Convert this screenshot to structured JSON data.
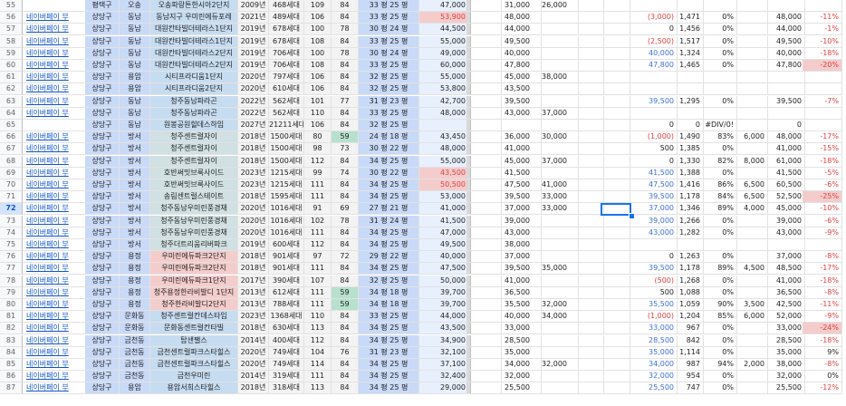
{
  "sheet": {
    "link_text": "네이버페이 부",
    "selected_row": "72",
    "rows": [
      {
        "n": "55",
        "d": "평택구",
        "t": "오송",
        "c": "오송파랑튼한시아2단지",
        "y": "2009년",
        "h": "468세대",
        "a": "109",
        "b": "84",
        "p": "33 평 25 평",
        "pr": "47,000",
        "hi": "",
        "p1": "31,000",
        "p2": "26,000",
        "chg": "",
        "v": "",
        "pct": "",
        "z": "",
        "w": "",
        "dr": ""
      },
      {
        "n": "56",
        "d": "상당구",
        "t": "동남",
        "c": "동남지구 우미린에듀포레",
        "y": "2021년",
        "h": "489세대",
        "a": "106",
        "b": "84",
        "p": "33 평 25 평",
        "pr": "53,900",
        "hi": "red",
        "p1": "48,000",
        "p2": "",
        "chg": "(3,000)",
        "v": "1,471",
        "pct": "0%",
        "z": "",
        "w": "48,000",
        "dr": "-11%"
      },
      {
        "n": "57",
        "d": "상당구",
        "t": "동남",
        "c": "대원칸타빌더테라스1단지",
        "y": "2019년",
        "h": "678세대",
        "a": "100",
        "b": "78",
        "p": "30 평 24 평",
        "pr": "44,500",
        "hi": "",
        "p1": "44,000",
        "p2": "",
        "chg": "0",
        "v": "1,456",
        "pct": "0%",
        "z": "",
        "w": "44,000",
        "dr": "-1%"
      },
      {
        "n": "58",
        "d": "상당구",
        "t": "동남",
        "c": "대원칸타빌더테라스1단지",
        "y": "2019년",
        "h": "678세대",
        "a": "108",
        "b": "84",
        "p": "33 평 25 평",
        "pr": "55,000",
        "hi": "",
        "p1": "49,500",
        "p2": "",
        "chg": "(2,500)",
        "v": "1,517",
        "pct": "0%",
        "z": "",
        "w": "49,500",
        "dr": "-10%"
      },
      {
        "n": "59",
        "d": "상당구",
        "t": "동남",
        "c": "대원칸타빌더테라스2단지",
        "y": "2019년",
        "h": "706세대",
        "a": "100",
        "b": "78",
        "p": "30 평 24 평",
        "pr": "49,000",
        "hi": "",
        "p1": "40,000",
        "p2": "",
        "chg": "40,000",
        "v": "1,324",
        "pct": "0%",
        "z": "",
        "w": "40,000",
        "dr": "-18%"
      },
      {
        "n": "60",
        "d": "상당구",
        "t": "동남",
        "c": "대원칸타빌더테라스2단지",
        "y": "2019년",
        "h": "706세대",
        "a": "108",
        "b": "84",
        "p": "33 평 25 평",
        "pr": "60,000",
        "hi": "",
        "p1": "47,800",
        "p2": "",
        "chg": "47,800",
        "v": "1,465",
        "pct": "0%",
        "z": "",
        "w": "47,800",
        "dr": "-20%"
      },
      {
        "n": "61",
        "d": "상당구",
        "t": "용암",
        "c": "시티프라디움1단지",
        "y": "2020년",
        "h": "797세대",
        "a": "106",
        "b": "84",
        "p": "32 평 25 평",
        "pr": "55,000",
        "hi": "",
        "p1": "45,000",
        "p2": "38,000",
        "chg": "",
        "v": "",
        "pct": "",
        "z": "",
        "w": "",
        "dr": ""
      },
      {
        "n": "62",
        "d": "상당구",
        "t": "용암",
        "c": "시티프라디움2단지",
        "y": "2020년",
        "h": "610세대",
        "a": "106",
        "b": "84",
        "p": "32 평 25 평",
        "pr": "53,800",
        "hi": "",
        "p1": "43,500",
        "p2": "",
        "chg": "",
        "v": "",
        "pct": "",
        "z": "",
        "w": "",
        "dr": ""
      },
      {
        "n": "63",
        "d": "상당구",
        "t": "동남",
        "c": "청주동남파라곤",
        "y": "2022년",
        "h": "562세대",
        "a": "101",
        "b": "77",
        "p": "31 평 23 평",
        "pr": "42,700",
        "hi": "",
        "p1": "39,500",
        "p2": "",
        "chg": "39,500",
        "v": "1,295",
        "pct": "0%",
        "z": "",
        "w": "39,500",
        "dr": "-7%"
      },
      {
        "n": "64",
        "d": "상당구",
        "t": "동남",
        "c": "청주동남파라곤",
        "y": "2022년",
        "h": "562세대",
        "a": "110",
        "b": "84",
        "p": "33 평 25 평",
        "pr": "48,000",
        "hi": "",
        "p1": "43,000",
        "p2": "37,000",
        "chg": "",
        "v": "",
        "pct": "",
        "z": "",
        "w": "",
        "dr": ""
      },
      {
        "n": "65",
        "d": "상당구",
        "t": "동남",
        "c": "원봉공원힐데스하임",
        "y": "2027년",
        "h": "21211세대",
        "a": "106",
        "b": "84",
        "p": "32 평 25 평",
        "pr": "",
        "hi": "",
        "p1": "",
        "p2": "",
        "chg": "0",
        "v": "0",
        "pct": "#DIV/0!",
        "z": "",
        "w": "0",
        "dr": ""
      },
      {
        "n": "66",
        "d": "상당구",
        "t": "방서",
        "c": "청주센트럴자이",
        "y": "2018년",
        "h": "1500세대",
        "a": "80",
        "b": "59",
        "p": "24 평 18 평",
        "pr": "43,450",
        "hi": "",
        "p1": "36,000",
        "p2": "30,000",
        "chg": "(1,000)",
        "v": "1,490",
        "pct": "83%",
        "z": "6,000",
        "w": "48,000",
        "dr": "-17%"
      },
      {
        "n": "67",
        "d": "상당구",
        "t": "방서",
        "c": "청주센트럴자이",
        "y": "2018년",
        "h": "1500세대",
        "a": "98",
        "b": "73",
        "p": "30 평 22 평",
        "pr": "48,000",
        "hi": "",
        "p1": "41,000",
        "p2": "",
        "chg": "500",
        "v": "1,385",
        "pct": "0%",
        "z": "",
        "w": "41,000",
        "dr": "-15%"
      },
      {
        "n": "68",
        "d": "상당구",
        "t": "방서",
        "c": "청주센트럴자이",
        "y": "2018년",
        "h": "1500세대",
        "a": "112",
        "b": "84",
        "p": "34 평 25 평",
        "pr": "55,000",
        "hi": "",
        "p1": "45,000",
        "p2": "37,000",
        "chg": "0",
        "v": "1,330",
        "pct": "82%",
        "z": "8,000",
        "w": "61,000",
        "dr": "-18%"
      },
      {
        "n": "69",
        "d": "상당구",
        "t": "방서",
        "c": "호반써밋브룩사이드",
        "y": "2023년",
        "h": "1215세대",
        "a": "99",
        "b": "74",
        "p": "30 평 22 평",
        "pr": "43,500",
        "hi": "red",
        "p1": "41,500",
        "p2": "",
        "chg": "41,500",
        "v": "1,388",
        "pct": "0%",
        "z": "",
        "w": "41,500",
        "dr": "-5%"
      },
      {
        "n": "70",
        "d": "상당구",
        "t": "방서",
        "c": "호반써밋브룩사이드",
        "y": "2023년",
        "h": "1215세대",
        "a": "111",
        "b": "84",
        "p": "34 평 25 평",
        "pr": "50,500",
        "hi": "red",
        "p1": "47,500",
        "p2": "41,000",
        "chg": "47,500",
        "v": "1,416",
        "pct": "86%",
        "z": "6,500",
        "w": "60,500",
        "dr": "-6%"
      },
      {
        "n": "71",
        "d": "상당구",
        "t": "방서",
        "c": "송림센트럴스테이트",
        "y": "2018년",
        "h": "1595세대",
        "a": "111",
        "b": "84",
        "p": "34 평 25 평",
        "pr": "53,000",
        "hi": "",
        "p1": "39,500",
        "p2": "33,000",
        "chg": "39,500",
        "v": "1,178",
        "pct": "84%",
        "z": "6,500",
        "w": "52,500",
        "dr": "-25%"
      },
      {
        "n": "72",
        "d": "상당구",
        "t": "방서",
        "c": "청주동남우미린풍경채",
        "y": "2020년",
        "h": "1016세대",
        "a": "91",
        "b": "69",
        "p": "27 평 21 평",
        "pr": "41,000",
        "hi": "",
        "p1": "37,000",
        "p2": "33,000",
        "chg": "37,000",
        "v": "1,346",
        "pct": "89%",
        "z": "4,000",
        "w": "45,000",
        "dr": "-10%"
      },
      {
        "n": "73",
        "d": "상당구",
        "t": "방서",
        "c": "청주동남우미린풍경채",
        "y": "2020년",
        "h": "1016세대",
        "a": "102",
        "b": "78",
        "p": "31 평 24 평",
        "pr": "41,500",
        "hi": "",
        "p1": "39,000",
        "p2": "",
        "chg": "39,000",
        "v": "1,266",
        "pct": "0%",
        "z": "",
        "w": "39,000",
        "dr": "-6%"
      },
      {
        "n": "74",
        "d": "상당구",
        "t": "방서",
        "c": "청주동남우미린풍경채",
        "y": "2020년",
        "h": "1016세대",
        "a": "111",
        "b": "84",
        "p": "34 평 25 평",
        "pr": "47,000",
        "hi": "",
        "p1": "43,000",
        "p2": "",
        "chg": "43,000",
        "v": "1,282",
        "pct": "0%",
        "z": "",
        "w": "43,000",
        "dr": "-9%"
      },
      {
        "n": "75",
        "d": "상당구",
        "t": "방서",
        "c": "청주더트리움리버파크",
        "y": "2019년",
        "h": "600세대",
        "a": "112",
        "b": "84",
        "p": "34 평 25 평",
        "pr": "49,500",
        "hi": "",
        "p1": "38,000",
        "p2": "",
        "chg": "",
        "v": "",
        "pct": "",
        "z": "",
        "w": "",
        "dr": ""
      },
      {
        "n": "76",
        "d": "상당구",
        "t": "용정",
        "c": "우미린에듀파크2단지",
        "y": "2018년",
        "h": "901세대",
        "a": "97",
        "b": "72",
        "p": "29 평 22 평",
        "pr": "40,000",
        "hi": "",
        "p1": "37,000",
        "p2": "",
        "chg": "0",
        "v": "1,263",
        "pct": "0%",
        "z": "",
        "w": "37,000",
        "dr": "-8%"
      },
      {
        "n": "77",
        "d": "상당구",
        "t": "용정",
        "c": "우미린에듀파크2단지",
        "y": "2018년",
        "h": "901세대",
        "a": "111",
        "b": "84",
        "p": "34 평 25 평",
        "pr": "47,500",
        "hi": "",
        "p1": "39,500",
        "p2": "35,000",
        "chg": "39,500",
        "v": "1,178",
        "pct": "89%",
        "z": "4,500",
        "w": "48,500",
        "dr": "-17%"
      },
      {
        "n": "78",
        "d": "상당구",
        "t": "용정",
        "c": "우미린에듀파크1단지",
        "y": "2017년",
        "h": "390세대",
        "a": "107",
        "b": "84",
        "p": "32 평 25 평",
        "pr": "50,000",
        "hi": "",
        "p1": "41,000",
        "p2": "",
        "chg": "(500)",
        "v": "1,268",
        "pct": "0%",
        "z": "",
        "w": "41,000",
        "dr": "-18%"
      },
      {
        "n": "79",
        "d": "상당구",
        "t": "용정",
        "c": "청주용정한라비발디 1단지",
        "y": "2013년",
        "h": "612세대",
        "a": "111",
        "b": "59",
        "p": "34 평 18 평",
        "pr": "39,700",
        "hi": "",
        "p1": "36,500",
        "p2": "",
        "chg": "500",
        "v": "1,088",
        "pct": "0%",
        "z": "",
        "w": "36,500",
        "dr": "-8%"
      },
      {
        "n": "80",
        "d": "상당구",
        "t": "용정",
        "c": "청주한라비발디2단지",
        "y": "2013년",
        "h": "788세대",
        "a": "111",
        "b": "59",
        "p": "34 평 18 평",
        "pr": "39,700",
        "hi": "",
        "p1": "35,500",
        "p2": "32,000",
        "chg": "35,500",
        "v": "1,059",
        "pct": "90%",
        "z": "3,500",
        "w": "42,500",
        "dr": "-11%"
      },
      {
        "n": "81",
        "d": "상당구",
        "t": "문화동",
        "c": "청주센트럴칸데스타임",
        "y": "2023년",
        "h": "1368세대",
        "a": "110",
        "b": "84",
        "p": "33 평 25 평",
        "pr": "44,000",
        "hi": "",
        "p1": "40,000",
        "p2": "34,000",
        "chg": "(1,000)",
        "v": "1,204",
        "pct": "85%",
        "z": "6,000",
        "w": "52,000",
        "dr": "-9%"
      },
      {
        "n": "82",
        "d": "상당구",
        "t": "문화동",
        "c": "문화동센트럴칸타빌",
        "y": "2018년",
        "h": "630세대",
        "a": "113",
        "b": "84",
        "p": "34 평 25 평",
        "pr": "43,500",
        "hi": "",
        "p1": "33,000",
        "p2": "",
        "chg": "33,000",
        "v": "967",
        "pct": "0%",
        "z": "",
        "w": "33,000",
        "dr": "-24%"
      },
      {
        "n": "83",
        "d": "상당구",
        "t": "금천동",
        "c": "탑샌팰스",
        "y": "2014년",
        "h": "400세대",
        "a": "112",
        "b": "84",
        "p": "34 평 25 평",
        "pr": "34,900",
        "hi": "",
        "p1": "28,500",
        "p2": "",
        "chg": "28,500",
        "v": "842",
        "pct": "0%",
        "z": "",
        "w": "28,500",
        "dr": "-18%"
      },
      {
        "n": "84",
        "d": "상당구",
        "t": "금천동",
        "c": "금천센트럴파크스타힐스",
        "y": "2020년",
        "h": "749세대",
        "a": "104",
        "b": "76",
        "p": "31 평 23 평",
        "pr": "32,100",
        "hi": "",
        "p1": "35,000",
        "p2": "",
        "chg": "35,000",
        "v": "1,114",
        "pct": "0%",
        "z": "",
        "w": "35,000",
        "dr": "9%"
      },
      {
        "n": "85",
        "d": "상당구",
        "t": "금천동",
        "c": "금천센트럴파크스타힐스",
        "y": "2020년",
        "h": "749세대",
        "a": "114",
        "b": "84",
        "p": "34 평 25 평",
        "pr": "37,100",
        "hi": "",
        "p1": "34,000",
        "p2": "32,000",
        "chg": "34,000",
        "v": "987",
        "pct": "94%",
        "z": "2,000",
        "w": "38,000",
        "dr": "-8%"
      },
      {
        "n": "86",
        "d": "상당구",
        "t": "금천동",
        "c": "금천우미린",
        "y": "2014년",
        "h": "319세대",
        "a": "111",
        "b": "84",
        "p": "34 평 25 평",
        "pr": "32,400",
        "hi": "",
        "p1": "32,000",
        "p2": "",
        "chg": "32,000",
        "v": "954",
        "pct": "0%",
        "z": "",
        "w": "32,000",
        "dr": "0%"
      },
      {
        "n": "87",
        "d": "상당구",
        "t": "용암",
        "c": "용암서희스타힐스",
        "y": "2018년",
        "h": "318세대",
        "a": "113",
        "b": "84",
        "p": "34 평 25 평",
        "pr": "29,000",
        "hi": "",
        "p1": "25,500",
        "p2": "",
        "chg": "25,500",
        "v": "747",
        "pct": "0%",
        "z": "",
        "w": "25,500",
        "dr": "-12%"
      }
    ]
  },
  "colors": {
    "dong": "#c9daf8",
    "complex_default": "#c6dcf0",
    "complex_yongjeong": "#f4cccc",
    "complex_bangseo": "#d0e0e3",
    "year": "#f3f3f3",
    "pyeong": "#c9daf8",
    "price": "#e8f0fe",
    "price_red": "#f4cccc",
    "green": "#b7e1cd",
    "red_rate": "#f4cccc"
  }
}
